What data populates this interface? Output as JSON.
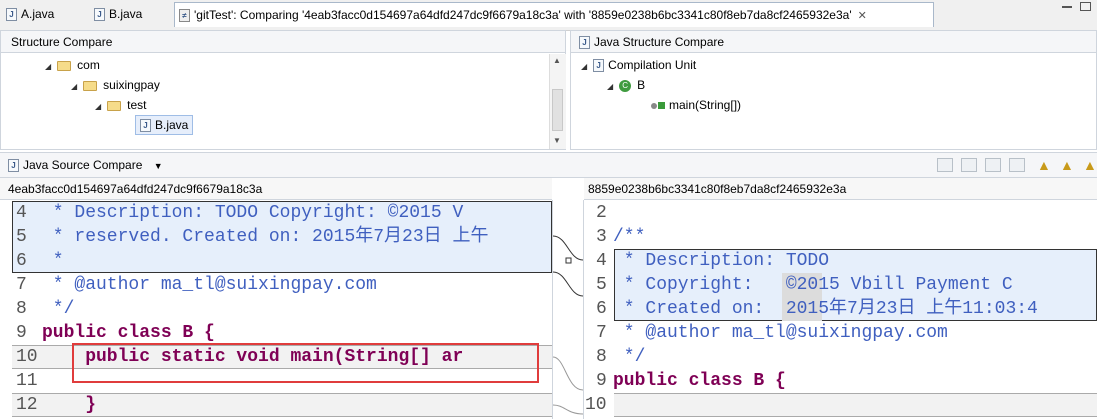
{
  "tabs": [
    {
      "label": "A.java",
      "icon": "java-file-icon"
    },
    {
      "label": "B.java",
      "icon": "java-file-icon"
    },
    {
      "label": "'gitTest': Comparing '4eab3facc0d154697a64dfd247dc9f6679a18c3a' with '8859e0238b6bc3341c80f8eb7da8cf2465932e3a'",
      "icon": "compare-icon",
      "active": true
    }
  ],
  "structure_compare": {
    "title": "Structure Compare",
    "tree": [
      {
        "label": "com",
        "level": 0
      },
      {
        "label": "suixingpay",
        "level": 1
      },
      {
        "label": "test",
        "level": 2
      },
      {
        "label": "B.java",
        "level": 3,
        "selected": true
      }
    ]
  },
  "java_structure_compare": {
    "title": "Java Structure Compare",
    "tree": [
      {
        "label": "Compilation Unit"
      },
      {
        "label": "B"
      },
      {
        "label": "main(String[])"
      }
    ]
  },
  "source_compare": {
    "title": "Java Source Compare",
    "left_header": "4eab3facc0d154697a64dfd247dc9f6679a18c3a",
    "right_header": "8859e0238b6bc3341c80f8eb7da8cf2465932e3a",
    "left_lines": [
      {
        "n": "4",
        "text": " * Description: TODO Copyright: ©2015 V"
      },
      {
        "n": "5",
        "text": " * reserved. Created on: 2015年7月23日 上午"
      },
      {
        "n": "6",
        "text": " *"
      },
      {
        "n": "7",
        "text": " * @author ma_tl@suixingpay.com"
      },
      {
        "n": "8",
        "text": " */"
      },
      {
        "n": "9",
        "text": "public class B {"
      },
      {
        "n": "10",
        "text": "    public static void main(String[] ar"
      },
      {
        "n": "11",
        "text": ""
      },
      {
        "n": "12",
        "text": "    }"
      }
    ],
    "right_lines": [
      {
        "n": "2",
        "text": ""
      },
      {
        "n": "3",
        "text": "/**"
      },
      {
        "n": "4",
        "text": " * Description: TODO"
      },
      {
        "n": "5",
        "text": " * Copyright:   ©2015 Vbill Payment C"
      },
      {
        "n": "6",
        "text": " * Created on:  2015年7月23日 上午11:03:4"
      },
      {
        "n": "7",
        "text": " * @author ma_tl@suixingpay.com"
      },
      {
        "n": "8",
        "text": " */"
      },
      {
        "n": "9",
        "text": "public class B {"
      },
      {
        "n": "10",
        "text": ""
      }
    ]
  },
  "colors": {
    "comment": "#3f5fbf",
    "keyword": "#7f0055",
    "annotation_box": "#e03c3c",
    "diff_highlight": "#e6effb"
  }
}
